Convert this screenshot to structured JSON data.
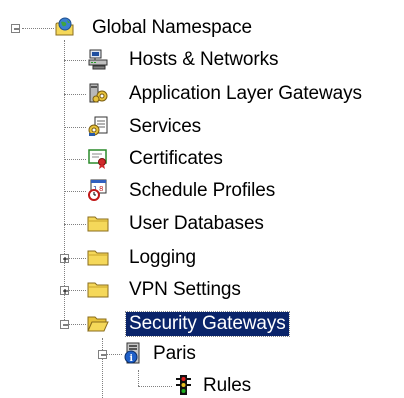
{
  "tree": {
    "root": {
      "label": "Global Namespace",
      "icon": "globe-folder-icon",
      "expanded": true
    },
    "items": [
      {
        "label": "Hosts & Networks",
        "icon": "network-hosts-icon"
      },
      {
        "label": "Application Layer Gateways",
        "icon": "gears-gateway-icon"
      },
      {
        "label": "Services",
        "icon": "services-icon"
      },
      {
        "label": "Certificates",
        "icon": "certificate-icon"
      },
      {
        "label": "Schedule Profiles",
        "icon": "calendar-clock-icon"
      },
      {
        "label": "User Databases",
        "icon": "folder-icon"
      },
      {
        "label": "Logging",
        "icon": "folder-icon",
        "expandable": true,
        "expanded": false
      },
      {
        "label": "VPN Settings",
        "icon": "folder-icon",
        "expandable": true,
        "expanded": false
      },
      {
        "label": "Security Gateways",
        "icon": "open-folder-icon",
        "expandable": true,
        "expanded": true,
        "selected": true
      }
    ],
    "gateway": {
      "label": "Paris",
      "icon": "gateway-server-icon",
      "expanded": true
    },
    "rules": {
      "label": "Rules",
      "icon": "traffic-light-icon"
    }
  },
  "colors": {
    "selection": "#0a246a",
    "selection_text": "#ffffff",
    "folder": "#f5d85a",
    "tree_lines": "#808080"
  }
}
